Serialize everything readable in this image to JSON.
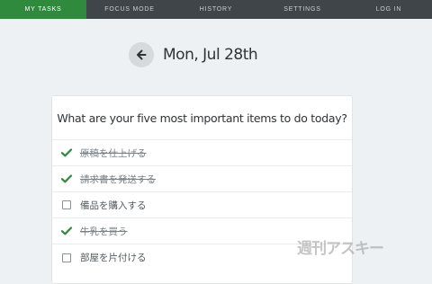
{
  "nav": {
    "items": [
      {
        "label": "MY TASKS",
        "active": true
      },
      {
        "label": "FOCUS MODE",
        "active": false
      },
      {
        "label": "HISTORY",
        "active": false
      },
      {
        "label": "SETTINGS",
        "active": false
      },
      {
        "label": "LOG IN",
        "active": false
      }
    ]
  },
  "header": {
    "back_icon": "arrow-left-icon",
    "date": "Mon, Jul 28th"
  },
  "card": {
    "title": "What are your five most important items to do today?",
    "tasks": [
      {
        "label": "原稿を仕上げる",
        "done": true
      },
      {
        "label": "請求書を発送する",
        "done": true
      },
      {
        "label": "備品を購入する",
        "done": false
      },
      {
        "label": "牛乳を買う",
        "done": true
      },
      {
        "label": "部屋を片付ける",
        "done": false
      }
    ]
  },
  "watermark": "週刊アスキー",
  "colors": {
    "accent": "#2f8a3e",
    "navbar": "#3f4548",
    "check": "#2f8a3e",
    "background": "#eef1f3"
  }
}
